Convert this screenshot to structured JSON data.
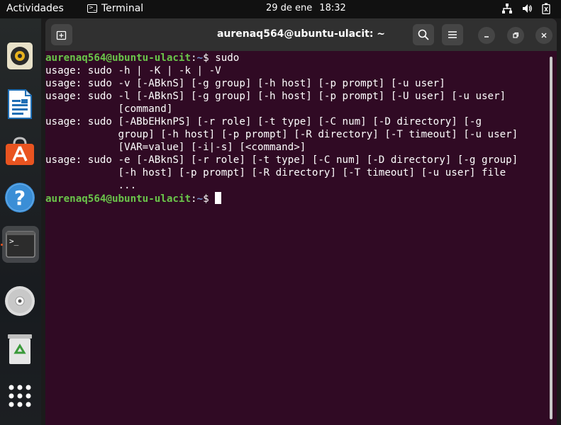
{
  "topbar": {
    "activities": "Actividades",
    "app_name": "Terminal",
    "date": "29 de ene",
    "time": "18:32"
  },
  "dock": {
    "items": [
      {
        "icon": "rhythmbox-icon"
      },
      {
        "icon": "libreoffice-writer-icon"
      },
      {
        "icon": "ubuntu-software-icon"
      },
      {
        "icon": "help-icon"
      },
      {
        "icon": "terminal-icon"
      },
      {
        "icon": "dvd-icon"
      },
      {
        "icon": "trash-icon"
      },
      {
        "icon": "app-grid-icon"
      }
    ]
  },
  "window": {
    "title": "aurenaq564@ubuntu-ulacit: ~"
  },
  "terminal": {
    "prompt_user": "aurenaq564@ubuntu-ulacit",
    "prompt_path": "~",
    "prompt_sep": ":",
    "prompt_symbol": "$",
    "command": "sudo",
    "output": [
      "usage: sudo -h | -K | -k | -V",
      "usage: sudo -v [-ABknS] [-g group] [-h host] [-p prompt] [-u user]",
      "usage: sudo -l [-ABknS] [-g group] [-h host] [-p prompt] [-U user] [-u user]",
      "            [command]",
      "usage: sudo [-ABbEHknPS] [-r role] [-t type] [-C num] [-D directory] [-g",
      "            group] [-h host] [-p prompt] [-R directory] [-T timeout] [-u user]",
      "            [VAR=value] [-i|-s] [<command>]",
      "usage: sudo -e [-ABknS] [-r role] [-t type] [-C num] [-D directory] [-g group]",
      "            [-h host] [-p prompt] [-R directory] [-T timeout] [-u user] file",
      "            ..."
    ]
  },
  "colors": {
    "terminal_bg": "#300a24",
    "prompt_user": "#6ac54a",
    "prompt_path": "#6f8fc7",
    "accent": "#e95420"
  }
}
